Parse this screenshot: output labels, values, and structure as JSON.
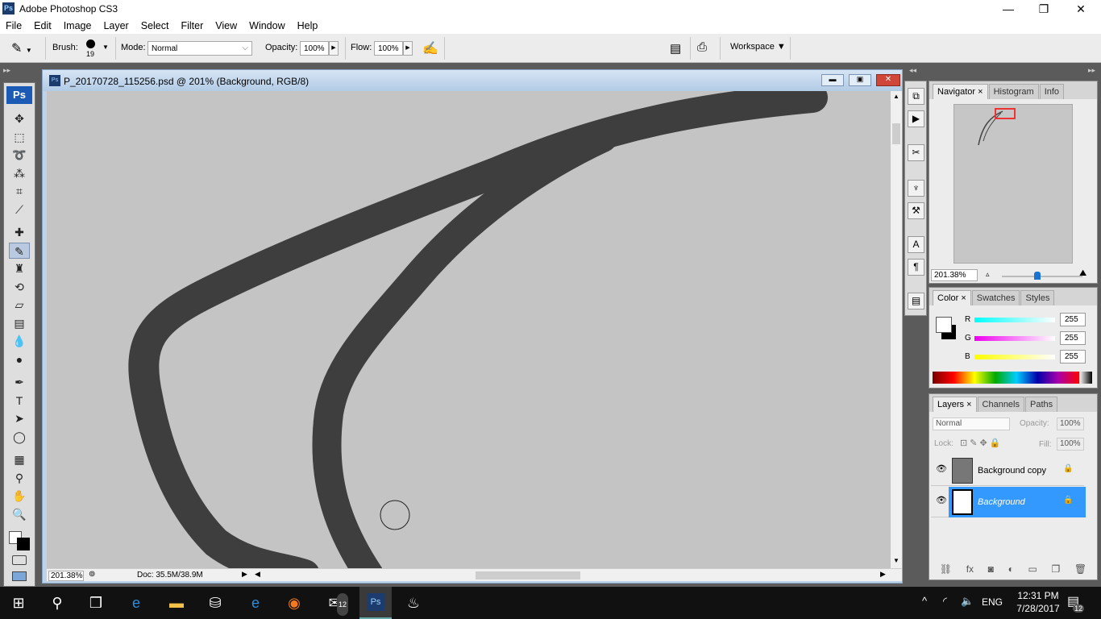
{
  "app": {
    "title": "Adobe Photoshop CS3",
    "logo": "Ps"
  },
  "window_controls": {
    "minimize": "—",
    "maximize": "❐",
    "close": "✕"
  },
  "menu": [
    "File",
    "Edit",
    "Image",
    "Layer",
    "Select",
    "Filter",
    "View",
    "Window",
    "Help"
  ],
  "options": {
    "brush_label": "Brush:",
    "brush_size": "19",
    "mode_label": "Mode:",
    "mode_value": "Normal",
    "opacity_label": "Opacity:",
    "opacity_value": "100%",
    "flow_label": "Flow:",
    "flow_value": "100%",
    "workspace_label": "Workspace ▼"
  },
  "toolbox": {
    "logo": "Ps",
    "tools": [
      {
        "name": "move",
        "glyph": "✥"
      },
      {
        "name": "marquee",
        "glyph": "⬚"
      },
      {
        "name": "lasso",
        "glyph": "➰"
      },
      {
        "name": "magic-wand",
        "glyph": "⁂"
      },
      {
        "name": "crop",
        "glyph": "⌗"
      },
      {
        "name": "slice",
        "glyph": "⟋"
      },
      {
        "name": "healing-brush",
        "glyph": "✚"
      },
      {
        "name": "brush",
        "glyph": "✎"
      },
      {
        "name": "clone-stamp",
        "glyph": "♜"
      },
      {
        "name": "history-brush",
        "glyph": "⟲"
      },
      {
        "name": "eraser",
        "glyph": "▱"
      },
      {
        "name": "gradient",
        "glyph": "▤"
      },
      {
        "name": "blur",
        "glyph": "💧"
      },
      {
        "name": "dodge",
        "glyph": "●"
      },
      {
        "name": "pen",
        "glyph": "✒"
      },
      {
        "name": "type",
        "glyph": "T"
      },
      {
        "name": "path-selection",
        "glyph": "➤"
      },
      {
        "name": "shape",
        "glyph": "◯"
      },
      {
        "name": "notes",
        "glyph": "▦"
      },
      {
        "name": "eyedropper",
        "glyph": "⚲"
      },
      {
        "name": "hand",
        "glyph": "✋"
      },
      {
        "name": "zoom",
        "glyph": "🔍"
      }
    ]
  },
  "document": {
    "title": "P_20170728_115256.psd @ 201% (Background, RGB/8)",
    "zoom": "201.38%",
    "doc_info": "Doc: 35.5M/38.9M"
  },
  "navigator": {
    "tabs": [
      "Navigator",
      "Histogram",
      "Info"
    ],
    "zoom": "201.38%"
  },
  "color": {
    "tabs": [
      "Color",
      "Swatches",
      "Styles"
    ],
    "channels": [
      {
        "label": "R",
        "value": "255"
      },
      {
        "label": "G",
        "value": "255"
      },
      {
        "label": "B",
        "value": "255"
      }
    ]
  },
  "layers": {
    "tabs": [
      "Layers",
      "Channels",
      "Paths"
    ],
    "blend_mode": "Normal",
    "opacity_label": "Opacity:",
    "opacity_value": "100%",
    "lock_label": "Lock:",
    "fill_label": "Fill:",
    "fill_value": "100%",
    "items": [
      {
        "name": "Background copy",
        "selected": false
      },
      {
        "name": "Background",
        "selected": true
      }
    ]
  },
  "taskbar": {
    "time": "12:31 PM",
    "date": "7/28/2017",
    "language": "ENG",
    "notifications": "12",
    "mail_badge": "12"
  },
  "colors": {
    "selection": "#3399ff",
    "accent": "#0078d7"
  }
}
